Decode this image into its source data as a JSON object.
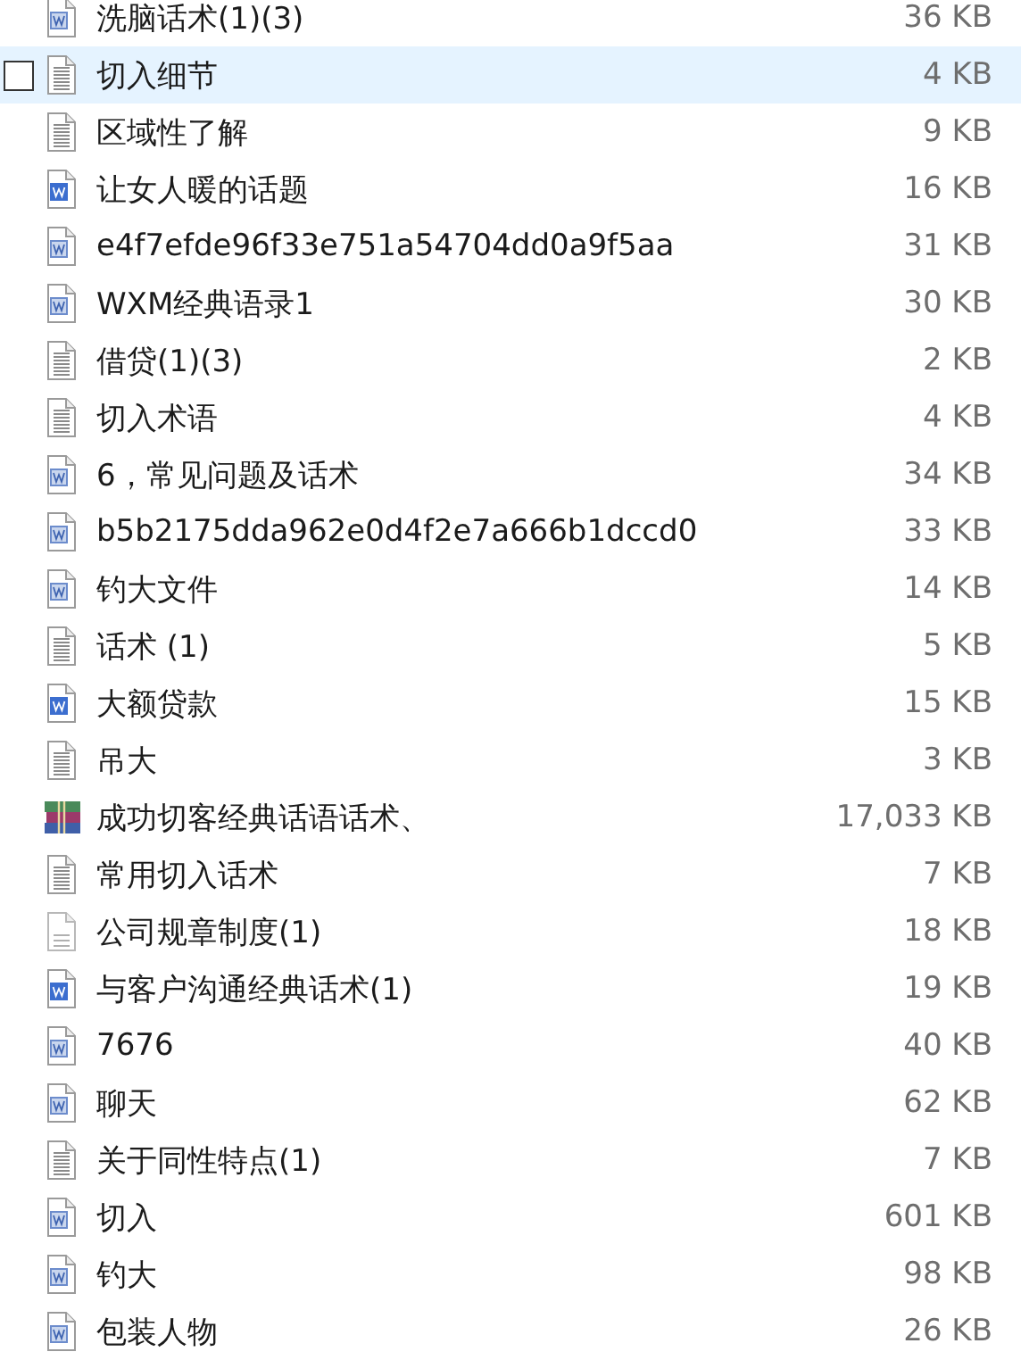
{
  "files": [
    {
      "name": "洗脑话术(1)(3)",
      "size": "36 KB",
      "kind": "word",
      "hovered": false
    },
    {
      "name": "切入细节",
      "size": "4 KB",
      "kind": "text",
      "hovered": true
    },
    {
      "name": "区域性了解",
      "size": "9 KB",
      "kind": "text",
      "hovered": false
    },
    {
      "name": "让女人暖的话题",
      "size": "16 KB",
      "kind": "docx",
      "hovered": false
    },
    {
      "name": "e4f7efde96f33e751a54704dd0a9f5aa",
      "size": "31 KB",
      "kind": "word",
      "hovered": false
    },
    {
      "name": "WXM经典语录1",
      "size": "30 KB",
      "kind": "word",
      "hovered": false
    },
    {
      "name": "借贷(1)(3)",
      "size": "2 KB",
      "kind": "text",
      "hovered": false
    },
    {
      "name": "切入术语",
      "size": "4 KB",
      "kind": "text",
      "hovered": false
    },
    {
      "name": "6，常见问题及话术",
      "size": "34 KB",
      "kind": "word",
      "hovered": false
    },
    {
      "name": "b5b2175dda962e0d4f2e7a666b1dccd0",
      "size": "33 KB",
      "kind": "word",
      "hovered": false
    },
    {
      "name": "钓大文件",
      "size": "14 KB",
      "kind": "word",
      "hovered": false
    },
    {
      "name": "话术 (1)",
      "size": "5 KB",
      "kind": "text",
      "hovered": false
    },
    {
      "name": "大额贷款",
      "size": "15 KB",
      "kind": "docx",
      "hovered": false
    },
    {
      "name": "吊大",
      "size": "3 KB",
      "kind": "text",
      "hovered": false
    },
    {
      "name": "成功切客经典话语话术、",
      "size": "17,033 KB",
      "kind": "archive",
      "hovered": false
    },
    {
      "name": "常用切入话术",
      "size": "7 KB",
      "kind": "text",
      "hovered": false
    },
    {
      "name": "公司规章制度(1)",
      "size": "18 KB",
      "kind": "note",
      "hovered": false
    },
    {
      "name": "与客户沟通经典话术(1)",
      "size": "19 KB",
      "kind": "docx",
      "hovered": false
    },
    {
      "name": "7676",
      "size": "40 KB",
      "kind": "word",
      "hovered": false
    },
    {
      "name": "聊天",
      "size": "62 KB",
      "kind": "word",
      "hovered": false
    },
    {
      "name": "关于同性特点(1)",
      "size": "7 KB",
      "kind": "text",
      "hovered": false
    },
    {
      "name": "切入",
      "size": "601 KB",
      "kind": "word",
      "hovered": false
    },
    {
      "name": "钓大",
      "size": "98 KB",
      "kind": "word",
      "hovered": false
    },
    {
      "name": "包装人物",
      "size": "26 KB",
      "kind": "word",
      "hovered": false
    }
  ]
}
